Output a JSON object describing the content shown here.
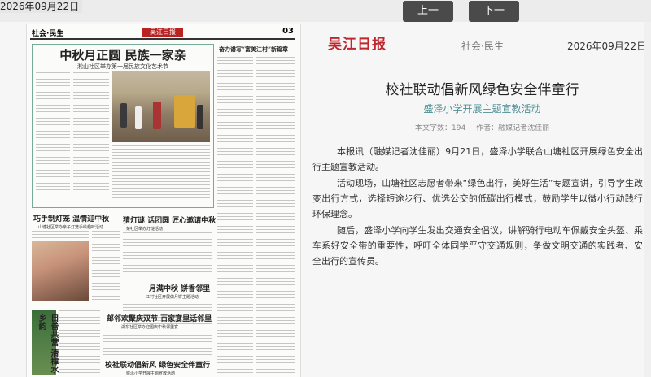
{
  "top_date": "2026年09月22日",
  "nav": {
    "prev": "上一期",
    "next": "下一期"
  },
  "newspaper": {
    "section": "社会·民生",
    "logo_text": "吴江日报",
    "page_no": "03",
    "lead_title": "中秋月正圆 民族一家亲",
    "lead_subtitle": "淞山社区举办第一届民族文化艺术节",
    "side_title": "奋力谱写“富美江村”新篇章",
    "story2_title": "巧手制灯笼 温情迎中秋",
    "story2_sub": "山塘社区举办亲子灯笼手绘趣味活动",
    "story3_title": "猜灯谜 话团圆 匠心邀请中秋",
    "story3_sub": "某社区举办灯谜活动",
    "story4_title": "月满中秋 饼香邻里",
    "story4_sub": "江村社区开展做月饼主题活动",
    "vertical_title": "自善共营 清樟水乡韵",
    "story5_title": "邮邻欢聚庆双节 百家宴里话邻里",
    "story5_sub": "湖东社区举办迎国庆中秋邻里宴",
    "story6_title": "校社联动倡新风 绿色安全伴童行",
    "story6_sub": "盛泽小学开展主题宣教活动"
  },
  "article": {
    "logo": "吴江日报",
    "section": "社会·民生",
    "date": "2026年09月22日",
    "title": "校社联动倡新风绿色安全伴童行",
    "subtitle": "盛泽小学开展主题宣教活动",
    "word_count": "本文字数：194",
    "author": "作者：融媒记者沈佳丽",
    "paragraphs": [
      "本报讯（融媒记者沈佳丽）9月21日，盛泽小学联合山塘社区开展绿色安全出行主题宣教活动。",
      "活动现场，山塘社区志愿者带来“绿色出行，美好生活”专题宣讲，引导学生改变出行方式，选择短途步行、优选公交的低碳出行模式，鼓励学生以微小行动践行环保理念。",
      "随后，盛泽小学向学生发出交通安全倡议，讲解骑行电动车佩戴安全头盔、乘车系好安全带的重要性，呼吁全体同学严守交通规则，争做文明交通的实践者、安全出行的宣传员。"
    ]
  },
  "colors": {
    "brand_red": "#c0272d",
    "subtitle_teal": "#4f8f94",
    "nav_button": "#4a4a4a"
  }
}
